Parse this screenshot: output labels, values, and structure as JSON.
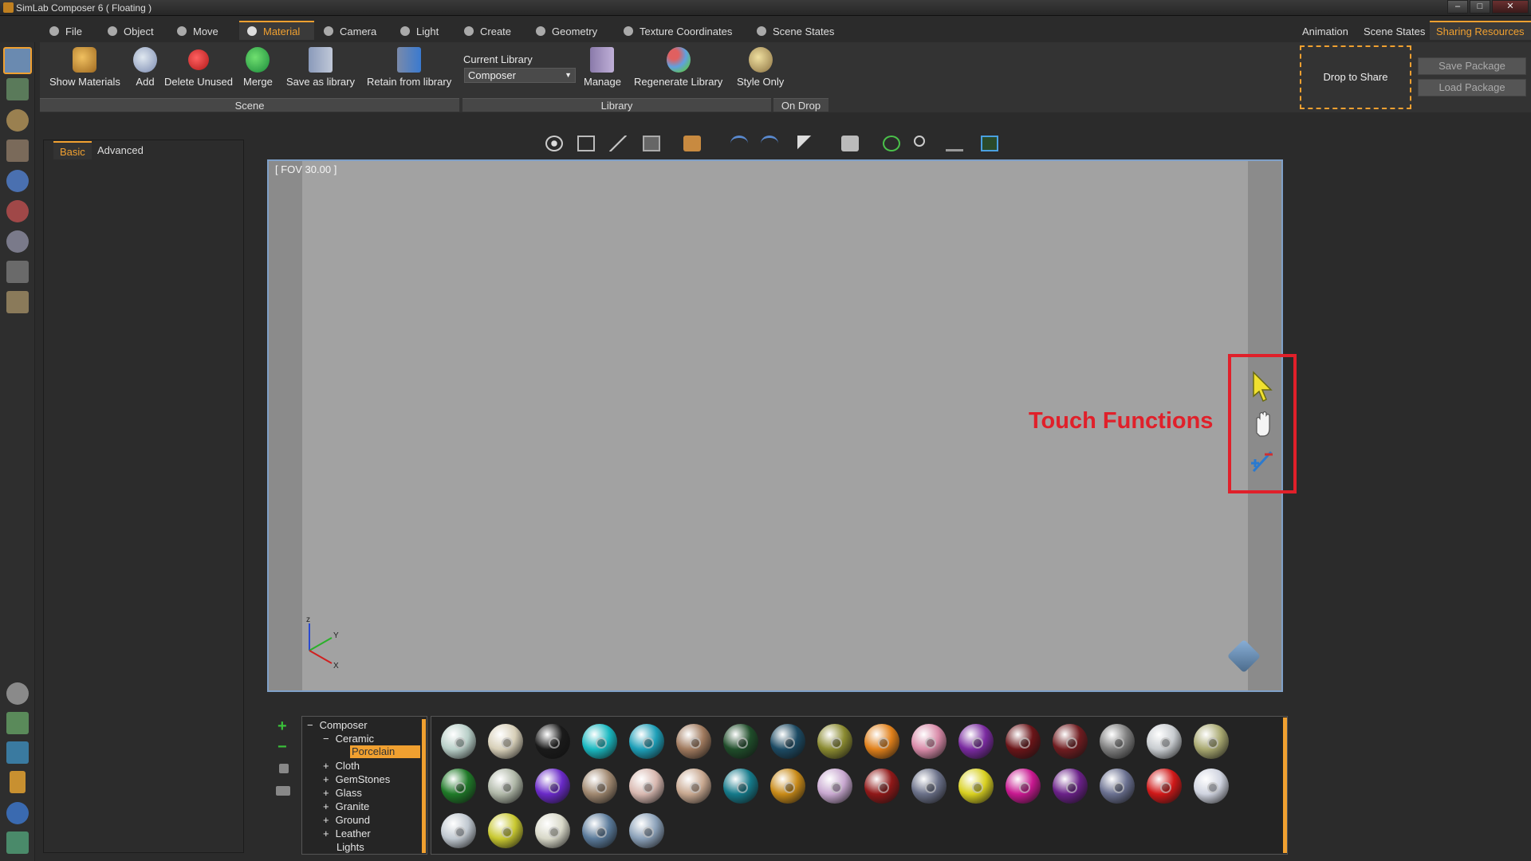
{
  "window": {
    "title": "SimLab Composer 6 ( Floating )",
    "controls": [
      "–",
      "□",
      "✕"
    ]
  },
  "menu_tabs": [
    {
      "label": "File"
    },
    {
      "label": "Object"
    },
    {
      "label": "Move"
    },
    {
      "label": "Material"
    },
    {
      "label": "Camera"
    },
    {
      "label": "Light"
    },
    {
      "label": "Create"
    },
    {
      "label": "Geometry"
    },
    {
      "label": "Texture Coordinates"
    },
    {
      "label": "Scene States"
    }
  ],
  "right_tabs": [
    {
      "label": "Animation"
    },
    {
      "label": "Scene States"
    },
    {
      "label": "Sharing Resources"
    }
  ],
  "ribbon": {
    "buttons": [
      {
        "label": "Show Materials"
      },
      {
        "label": "Add"
      },
      {
        "label": "Delete Unused"
      },
      {
        "label": "Merge"
      },
      {
        "label": "Save as library"
      },
      {
        "label": "Retain from library"
      },
      {
        "label": "Manage"
      },
      {
        "label": "Regenerate Library"
      },
      {
        "label": "Style Only"
      }
    ],
    "current_library_label": "Current Library",
    "current_library_value": "Composer",
    "groups": [
      {
        "label": "Scene"
      },
      {
        "label": "Library"
      },
      {
        "label": "On Drop"
      }
    ]
  },
  "sharing": {
    "drop_label": "Drop to Share",
    "save_label": "Save Package",
    "load_label": "Load Package"
  },
  "left_panel": {
    "tabs": [
      {
        "label": "Basic"
      },
      {
        "label": "Advanced"
      }
    ]
  },
  "viewport": {
    "fov_text": "[ FOV 30.00 ]",
    "touch_label": "Touch Functions",
    "axes": {
      "z": "z",
      "y": "Y",
      "x": "X"
    }
  },
  "tree": {
    "nodes": [
      {
        "label": "Composer",
        "sign": "−"
      },
      {
        "label": "Ceramic",
        "sign": "−"
      },
      {
        "label": "Porcelain",
        "sign": ""
      },
      {
        "label": "Cloth",
        "sign": "+"
      },
      {
        "label": "GemStones",
        "sign": "+"
      },
      {
        "label": "Glass",
        "sign": "+"
      },
      {
        "label": "Granite",
        "sign": "+"
      },
      {
        "label": "Ground",
        "sign": "+"
      },
      {
        "label": "Leather",
        "sign": "+"
      },
      {
        "label": "Lights",
        "sign": ""
      }
    ]
  },
  "swatch_colors": [
    "#b8cfc8",
    "#d7cfb8",
    "#1a1a1a",
    "#19b8c0",
    "#1d9fb8",
    "#a07a5e",
    "#1f4d2a",
    "#1c4a63",
    "#8a8a30",
    "#e0801a",
    "#d88aa8",
    "#7a2aa0",
    "#6a1418",
    "#701c20",
    "#7e7e7e",
    "#c8ccd0",
    "#a8a870",
    "#1f7a28",
    "#b0b8a8",
    "#6a2ac8",
    "#a08870",
    "#d8b8b0",
    "#c8a890",
    "#157a8a",
    "#c88a18",
    "#c8a8d0",
    "#901818",
    "#6a7088",
    "#d8d020",
    "#c81890",
    "#6a2088",
    "#6a7090",
    "#d01818",
    "#d0d4e0",
    "#c0c8d0",
    "#c8c830",
    "#d8d8c8",
    "#5a7a9a",
    "#8aa0b8"
  ]
}
